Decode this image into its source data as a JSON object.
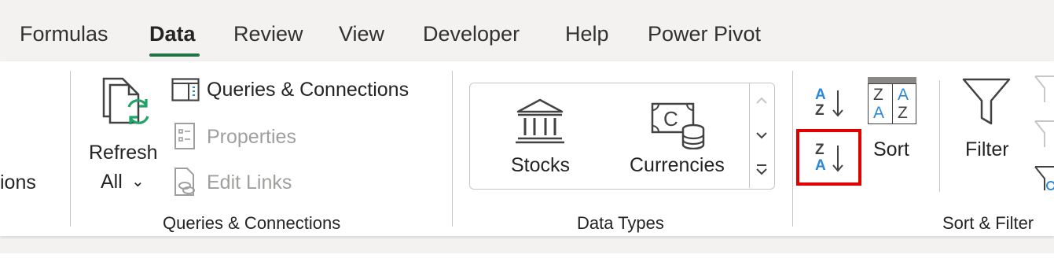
{
  "tabs": [
    {
      "label": "Formulas",
      "active": false
    },
    {
      "label": "Data",
      "active": true
    },
    {
      "label": "Review",
      "active": false
    },
    {
      "label": "View",
      "active": false
    },
    {
      "label": "Developer",
      "active": false
    },
    {
      "label": "Help",
      "active": false
    },
    {
      "label": "Power Pivot",
      "active": false
    }
  ],
  "ribbon": {
    "partial_left_label": "ions",
    "refresh_all": {
      "line1": "Refresh",
      "line2": "All",
      "dropdown": "⌄"
    },
    "queries_connections_btn": "Queries & Connections",
    "properties_btn": "Properties",
    "edit_links_btn": "Edit Links",
    "group_queries": "Queries & Connections",
    "stocks_label": "Stocks",
    "currencies_label": "Currencies",
    "group_datatypes": "Data Types",
    "sort_az": {
      "top": "A",
      "bottom": "Z"
    },
    "sort_za": {
      "top": "Z",
      "bottom": "A"
    },
    "sort_label": "Sort",
    "sort_icon_letters": {
      "tl": "Z",
      "tr": "A",
      "bl": "A",
      "br": "Z"
    },
    "filter_label": "Filter",
    "group_sortfilter": "Sort & Filter"
  },
  "colors": {
    "accent_tab": "#217346",
    "az_blue": "#2b88d8",
    "refresh_green": "#21a366",
    "highlight": "#e00000"
  }
}
